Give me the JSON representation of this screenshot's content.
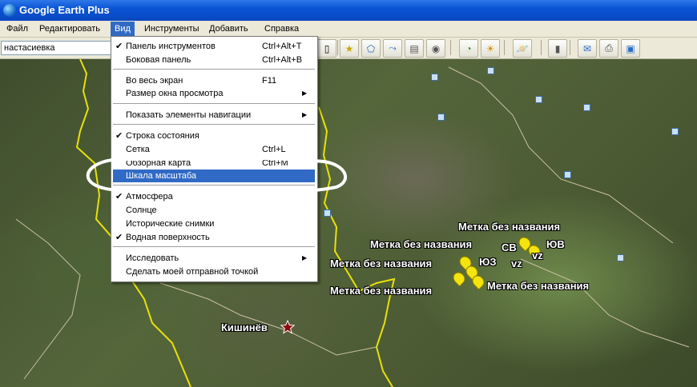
{
  "window": {
    "title": "Google Earth Plus"
  },
  "menubar": {
    "items": [
      {
        "label": "Файл"
      },
      {
        "label": "Редактировать"
      },
      {
        "label": "Вид"
      },
      {
        "label": "Инструменты"
      },
      {
        "label": "Добавить"
      },
      {
        "label": "Справка"
      }
    ]
  },
  "search": {
    "value": "настасиевка"
  },
  "view_menu": {
    "items": [
      {
        "label": "Панель инструментов",
        "shortcut": "Ctrl+Alt+T",
        "checked": true
      },
      {
        "label": "Боковая панель",
        "shortcut": "Ctrl+Alt+B",
        "checked": false
      },
      {
        "label": "Во весь экран",
        "shortcut": "F11",
        "checked": false
      },
      {
        "label": "Размер окна просмотра",
        "shortcut": "",
        "submenu": true
      },
      {
        "label": "Показать элементы навигации",
        "shortcut": "",
        "submenu": true
      },
      {
        "label": "Строка состояния",
        "shortcut": "",
        "checked": true
      },
      {
        "label": "Сетка",
        "shortcut": "Ctrl+L",
        "checked": false
      },
      {
        "label": "Обзорная карта",
        "shortcut": "Ctrl+M",
        "checked": false
      },
      {
        "label": "Шкала масштаба",
        "shortcut": "",
        "highlighted": true
      },
      {
        "label": "Атмосфера",
        "shortcut": "",
        "checked": true
      },
      {
        "label": "Солнце",
        "shortcut": "",
        "checked": false
      },
      {
        "label": "Исторические снимки",
        "shortcut": "",
        "checked": false
      },
      {
        "label": "Водная поверхность",
        "shortcut": "",
        "checked": true
      },
      {
        "label": "Исследовать",
        "shortcut": "",
        "submenu": true
      },
      {
        "label": "Сделать моей отправной точкой",
        "shortcut": ""
      }
    ],
    "check_mark": "✔",
    "submenu_arrow": "▶"
  },
  "map": {
    "placemarks": [
      {
        "label": "Метка без названия"
      },
      {
        "label": "Метка без названия"
      },
      {
        "label": "Метка без названия"
      },
      {
        "label": "Метка без названия"
      },
      {
        "label": "Метка без названия"
      }
    ],
    "direction_labels": [
      "СВ",
      "ЮВ",
      "ЮЗ",
      "vz",
      "vz"
    ],
    "city": {
      "label": "Кишинёв"
    }
  },
  "colors": {
    "menu_highlight": "#316ac5",
    "border_yellow": "#e8e00a",
    "annotation": "#ffffff"
  }
}
